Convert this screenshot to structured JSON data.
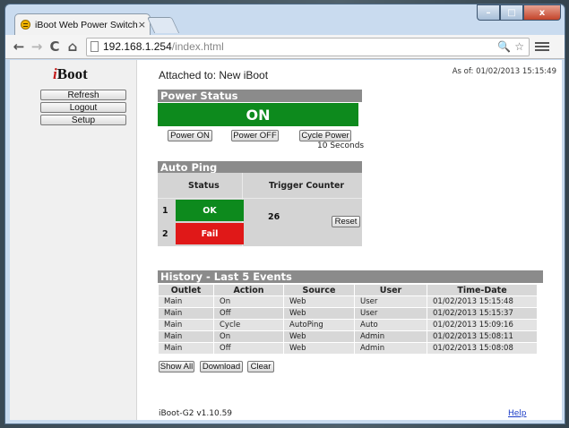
{
  "browser": {
    "tab_title": "iBoot Web Power Switch",
    "tab_close": "×",
    "url_host": "192.168.1.254",
    "url_path": "/index.html",
    "nav": {
      "back": "←",
      "forward": "→",
      "reload": "C",
      "home": "⌂"
    },
    "zoom_icon": "🔍",
    "star_icon": "☆",
    "window": {
      "minimize": "–",
      "maximize": "□",
      "close": "x"
    }
  },
  "sidebar": {
    "logo_i": "i",
    "logo_rest": "Boot",
    "buttons": {
      "refresh": "Refresh",
      "logout": "Logout",
      "setup": "Setup"
    }
  },
  "header": {
    "attached": "Attached to: New iBoot",
    "as_of": "As of: 01/02/2013 15:15:49"
  },
  "power": {
    "title": "Power Status",
    "state": "ON",
    "state_color": "#0d8a1d",
    "buttons": {
      "on": "Power ON",
      "off": "Power OFF",
      "cycle": "Cycle Power"
    },
    "cycle_note": "10 Seconds"
  },
  "auto_ping": {
    "title": "Auto Ping",
    "col_status": "Status",
    "col_trigger": "Trigger Counter",
    "rows": [
      {
        "num": "1",
        "status": "OK",
        "color": "#0d8a1d"
      },
      {
        "num": "2",
        "status": "Fail",
        "color": "#e01818"
      }
    ],
    "trigger_count": "26",
    "reset_label": "Reset"
  },
  "history": {
    "title": "History - Last 5 Events",
    "columns": [
      "Outlet",
      "Action",
      "Source",
      "User",
      "Time-Date"
    ],
    "rows": [
      [
        "Main",
        "On",
        "Web",
        "User",
        "01/02/2013 15:15:48"
      ],
      [
        "Main",
        "Off",
        "Web",
        "User",
        "01/02/2013 15:15:37"
      ],
      [
        "Main",
        "Cycle",
        "AutoPing",
        "Auto",
        "01/02/2013 15:09:16"
      ],
      [
        "Main",
        "On",
        "Web",
        "Admin",
        "01/02/2013 15:08:11"
      ],
      [
        "Main",
        "Off",
        "Web",
        "Admin",
        "01/02/2013 15:08:08"
      ]
    ],
    "buttons": {
      "show_all": "Show All",
      "download": "Download",
      "clear": "Clear"
    }
  },
  "footer": {
    "version": "iBoot-G2 v1.10.59",
    "help": "Help"
  }
}
